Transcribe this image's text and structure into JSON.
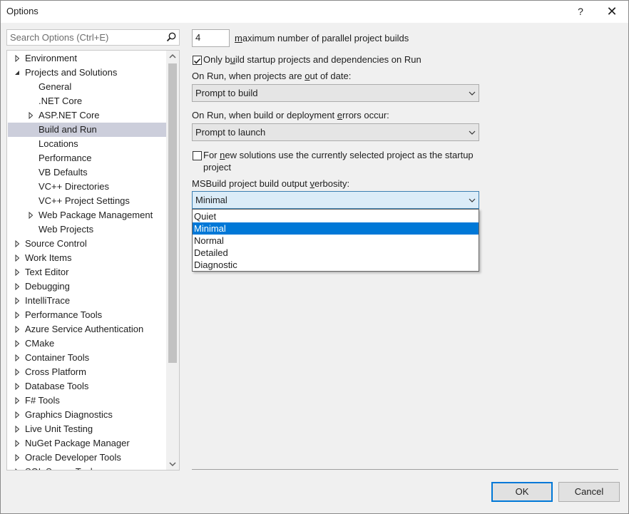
{
  "window": {
    "title": "Options",
    "help_label": "?",
    "close_label": "✕"
  },
  "search": {
    "placeholder": "Search Options (Ctrl+E)"
  },
  "tree": {
    "items": [
      {
        "label": "Environment",
        "expander": "collapsed",
        "indent": 0
      },
      {
        "label": "Projects and Solutions",
        "expander": "expanded",
        "indent": 0
      },
      {
        "label": "General",
        "expander": "none",
        "indent": 1
      },
      {
        "label": ".NET Core",
        "expander": "none",
        "indent": 1
      },
      {
        "label": "ASP.NET Core",
        "expander": "collapsed",
        "indent": 1
      },
      {
        "label": "Build and Run",
        "expander": "none",
        "indent": 1,
        "selected": true
      },
      {
        "label": "Locations",
        "expander": "none",
        "indent": 1
      },
      {
        "label": "Performance",
        "expander": "none",
        "indent": 1
      },
      {
        "label": "VB Defaults",
        "expander": "none",
        "indent": 1
      },
      {
        "label": "VC++ Directories",
        "expander": "none",
        "indent": 1
      },
      {
        "label": "VC++ Project Settings",
        "expander": "none",
        "indent": 1
      },
      {
        "label": "Web Package Management",
        "expander": "collapsed",
        "indent": 1
      },
      {
        "label": "Web Projects",
        "expander": "none",
        "indent": 1
      },
      {
        "label": "Source Control",
        "expander": "collapsed",
        "indent": 0
      },
      {
        "label": "Work Items",
        "expander": "collapsed",
        "indent": 0
      },
      {
        "label": "Text Editor",
        "expander": "collapsed",
        "indent": 0
      },
      {
        "label": "Debugging",
        "expander": "collapsed",
        "indent": 0
      },
      {
        "label": "IntelliTrace",
        "expander": "collapsed",
        "indent": 0
      },
      {
        "label": "Performance Tools",
        "expander": "collapsed",
        "indent": 0
      },
      {
        "label": "Azure Service Authentication",
        "expander": "collapsed",
        "indent": 0
      },
      {
        "label": "CMake",
        "expander": "collapsed",
        "indent": 0
      },
      {
        "label": "Container Tools",
        "expander": "collapsed",
        "indent": 0
      },
      {
        "label": "Cross Platform",
        "expander": "collapsed",
        "indent": 0
      },
      {
        "label": "Database Tools",
        "expander": "collapsed",
        "indent": 0
      },
      {
        "label": "F# Tools",
        "expander": "collapsed",
        "indent": 0
      },
      {
        "label": "Graphics Diagnostics",
        "expander": "collapsed",
        "indent": 0
      },
      {
        "label": "Live Unit Testing",
        "expander": "collapsed",
        "indent": 0
      },
      {
        "label": "NuGet Package Manager",
        "expander": "collapsed",
        "indent": 0
      },
      {
        "label": "Oracle Developer Tools",
        "expander": "collapsed",
        "indent": 0
      },
      {
        "label": "SQL Server Tools",
        "expander": "collapsed",
        "indent": 0
      }
    ]
  },
  "settings": {
    "parallel_builds": {
      "value": "4",
      "label_pre": "",
      "label_accel": "m",
      "label_post": "aximum number of parallel project builds"
    },
    "only_build_startup": {
      "checked": true,
      "label_pre": "Only b",
      "label_accel": "u",
      "label_post": "ild startup projects and dependencies on Run"
    },
    "on_run_out_of_date": {
      "label_pre": "On Run, when projects are ",
      "label_accel": "o",
      "label_post": "ut of date:",
      "selected": "Prompt to build"
    },
    "on_run_build_errors": {
      "label_pre": "On Run, when build or deployment ",
      "label_accel": "e",
      "label_post": "rrors occur:",
      "selected": "Prompt to launch"
    },
    "new_solutions_startup": {
      "checked": false,
      "label_pre": "For ",
      "label_accel": "n",
      "label_post": "ew solutions use the currently selected project as the startup",
      "label_line2": "project"
    },
    "msbuild_verbosity": {
      "label_pre": "MSBuild project build output ",
      "label_accel": "v",
      "label_post": "erbosity:",
      "selected": "Minimal",
      "options": [
        "Quiet",
        "Minimal",
        "Normal",
        "Detailed",
        "Diagnostic"
      ],
      "highlighted_index": 1
    }
  },
  "buttons": {
    "ok": "OK",
    "cancel": "Cancel"
  },
  "colors": {
    "selection_blue": "#0078d7",
    "tree_selected": "#cccedb"
  }
}
